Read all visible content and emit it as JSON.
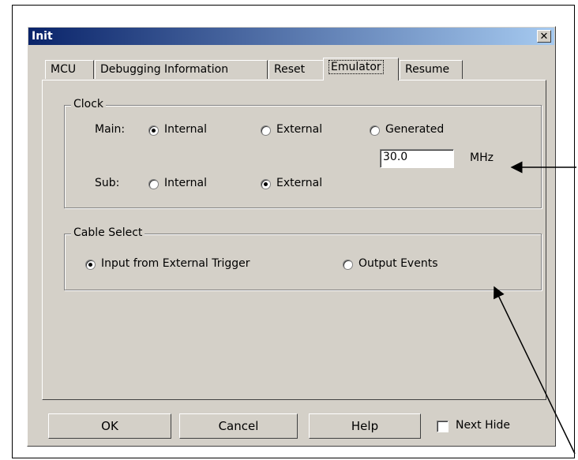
{
  "window": {
    "title": "Init",
    "close_symbol": "✕"
  },
  "tabs": [
    {
      "label": "MCU",
      "active": false
    },
    {
      "label": "Debugging Information",
      "active": false
    },
    {
      "label": "Reset",
      "active": false
    },
    {
      "label": "Emulator",
      "active": true
    },
    {
      "label": "Resume",
      "active": false
    }
  ],
  "clock": {
    "title": "Clock",
    "main_label": "Main:",
    "main_options": [
      {
        "label": "Internal",
        "checked": true
      },
      {
        "label": "External",
        "checked": false
      },
      {
        "label": "Generated",
        "checked": false
      }
    ],
    "frequency_value": "30.0",
    "frequency_unit": "MHz",
    "sub_label": "Sub:",
    "sub_options": [
      {
        "label": "Internal",
        "checked": false
      },
      {
        "label": "External",
        "checked": true
      }
    ]
  },
  "cable_select": {
    "title": "Cable Select",
    "options": [
      {
        "label": "Input from External Trigger",
        "checked": true
      },
      {
        "label": "Output Events",
        "checked": false
      }
    ]
  },
  "buttons": {
    "ok": "OK",
    "cancel": "Cancel",
    "help": "Help"
  },
  "next_hide": {
    "label": "Next Hide",
    "checked": false
  }
}
